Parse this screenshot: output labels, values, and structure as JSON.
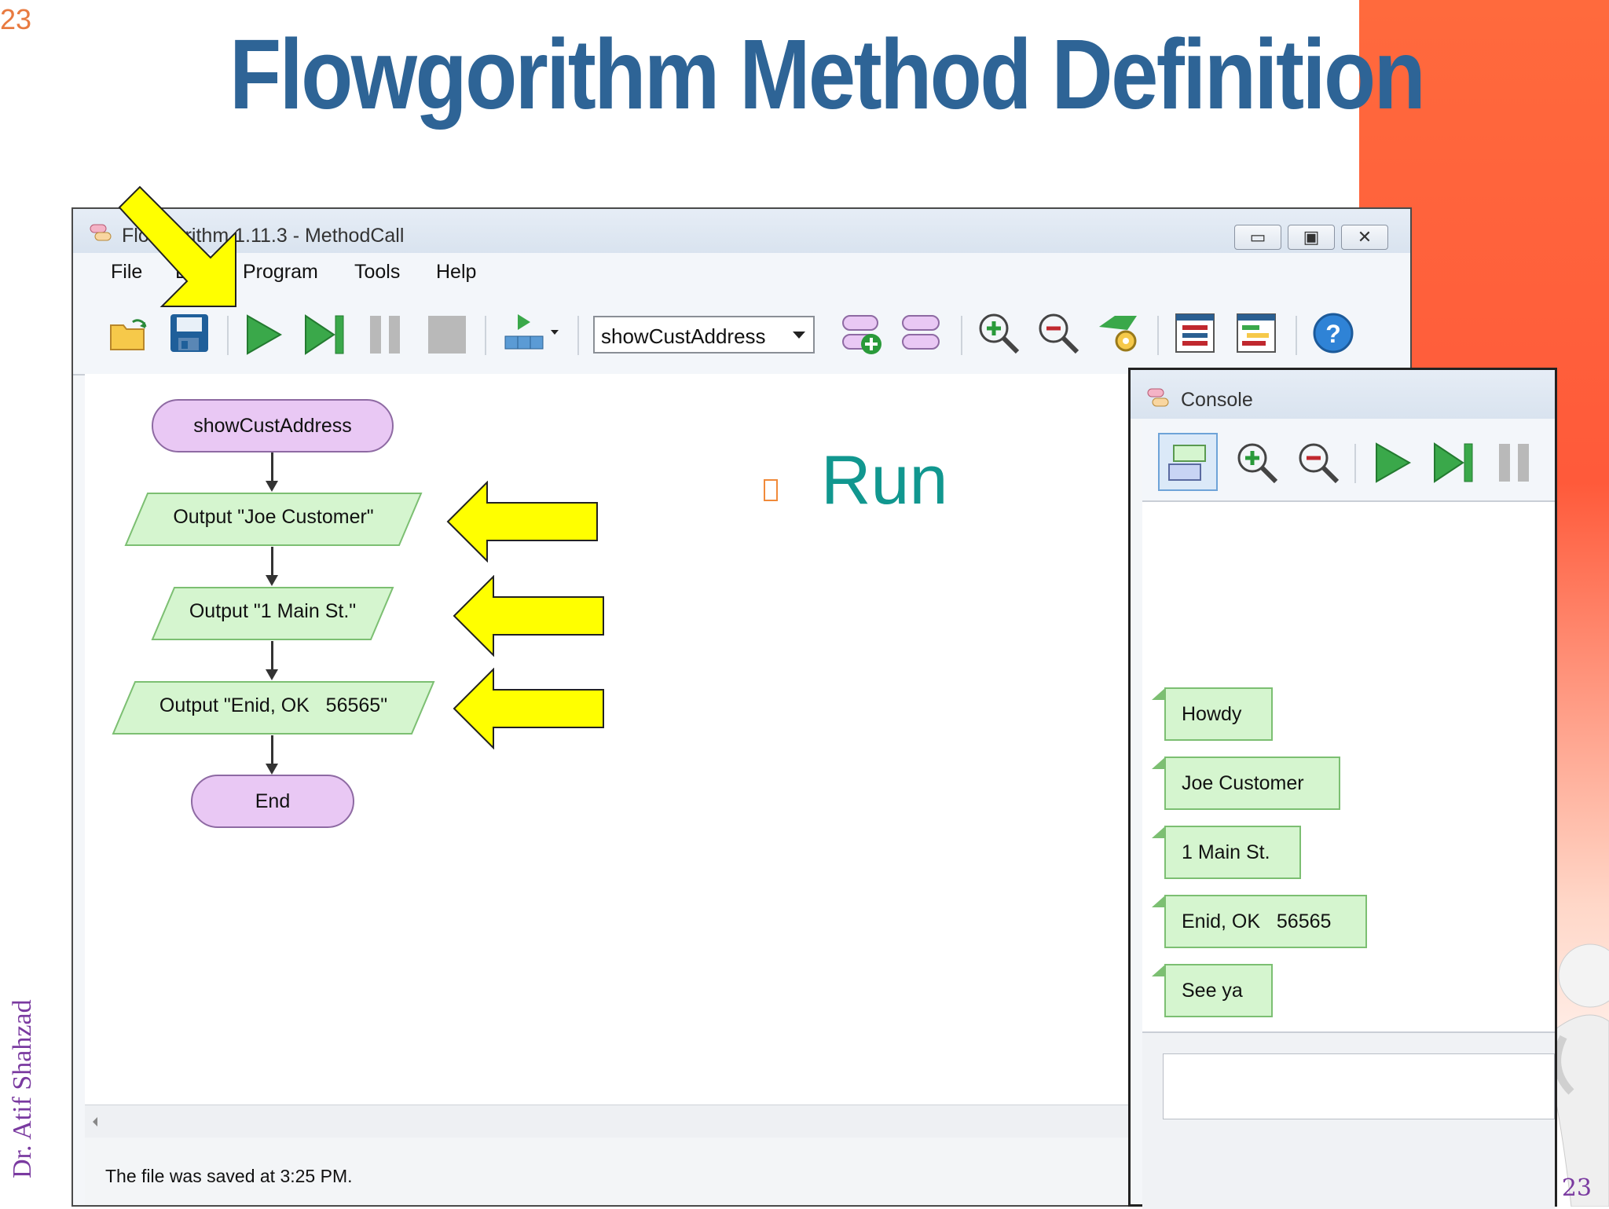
{
  "slide": {
    "number": "23",
    "number_bottom": "23",
    "title": "Flowgorithm Method Definition",
    "author": "Dr. Atif Shahzad",
    "bullet_text": "Run"
  },
  "app_window": {
    "title": "Flowgorithm 1.11.3 - MethodCall",
    "menu": [
      "File",
      "Edit",
      "Program",
      "Tools",
      "Help"
    ],
    "function_select": "showCustAddress",
    "status": "The file was saved at 3:25 PM."
  },
  "flowchart": {
    "start": "showCustAddress",
    "outputs": [
      "Output \"Joe Customer\"",
      "Output \"1 Main St.\"",
      "Output \"Enid, OK   56565\""
    ],
    "end": "End"
  },
  "console": {
    "title": "Console",
    "messages": [
      "Howdy",
      "Joe Customer",
      "1 Main St.",
      "Enid, OK   56565",
      "See ya"
    ],
    "input_value": ""
  },
  "colors": {
    "title_blue": "#2e6496",
    "run_teal": "#11978f",
    "terminal_fill": "#e9c8f4",
    "io_fill": "#d5f5cf",
    "arrow_yellow": "#ffff00"
  }
}
